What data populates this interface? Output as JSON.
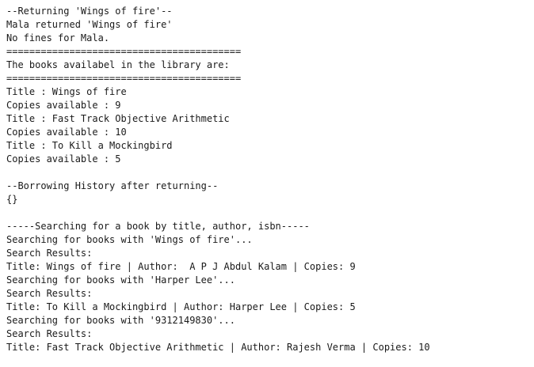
{
  "output": {
    "lines": [
      "--Returning 'Wings of fire'--",
      "Mala returned 'Wings of fire'",
      "No fines for Mala.",
      "=========================================",
      "The books availabel in the library are:",
      "=========================================",
      "Title : Wings of fire",
      "Copies available : 9",
      "Title : Fast Track Objective Arithmetic",
      "Copies available : 10",
      "Title : To Kill a Mockingbird",
      "Copies available : 5",
      "",
      "--Borrowing History after returning--",
      "{}",
      "",
      "-----Searching for a book by title, author, isbn-----",
      "Searching for books with 'Wings of fire'...",
      "Search Results:",
      "Title: Wings of fire | Author:  A P J Abdul Kalam | Copies: 9",
      "Searching for books with 'Harper Lee'...",
      "Search Results:",
      "Title: To Kill a Mockingbird | Author: Harper Lee | Copies: 5",
      "Searching for books with '9312149830'...",
      "Search Results:",
      "Title: Fast Track Objective Arithmetic | Author: Rajesh Verma | Copies: 10"
    ]
  }
}
